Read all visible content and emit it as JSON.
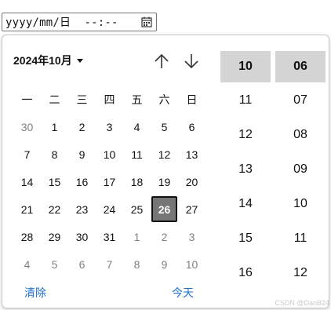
{
  "input": {
    "value": "yyyy/mm/日  --:--",
    "icon": "calendar-icon"
  },
  "calendar": {
    "month_label": "2024年10月",
    "weekdays": [
      "一",
      "二",
      "三",
      "四",
      "五",
      "六",
      "日"
    ],
    "weeks": [
      [
        {
          "d": "30",
          "other": true
        },
        {
          "d": "1"
        },
        {
          "d": "2"
        },
        {
          "d": "3"
        },
        {
          "d": "4"
        },
        {
          "d": "5"
        },
        {
          "d": "6"
        }
      ],
      [
        {
          "d": "7"
        },
        {
          "d": "8"
        },
        {
          "d": "9"
        },
        {
          "d": "10"
        },
        {
          "d": "11"
        },
        {
          "d": "12"
        },
        {
          "d": "13"
        }
      ],
      [
        {
          "d": "14"
        },
        {
          "d": "15"
        },
        {
          "d": "16"
        },
        {
          "d": "17"
        },
        {
          "d": "18"
        },
        {
          "d": "19"
        },
        {
          "d": "20"
        }
      ],
      [
        {
          "d": "21"
        },
        {
          "d": "22"
        },
        {
          "d": "23"
        },
        {
          "d": "24"
        },
        {
          "d": "25"
        },
        {
          "d": "26",
          "selected": true
        },
        {
          "d": "27"
        }
      ],
      [
        {
          "d": "28"
        },
        {
          "d": "29"
        },
        {
          "d": "30"
        },
        {
          "d": "31"
        },
        {
          "d": "1",
          "other": true
        },
        {
          "d": "2",
          "other": true
        },
        {
          "d": "3",
          "other": true
        }
      ],
      [
        {
          "d": "4",
          "other": true
        },
        {
          "d": "5",
          "other": true
        },
        {
          "d": "6",
          "other": true
        },
        {
          "d": "7",
          "other": true
        },
        {
          "d": "8",
          "other": true
        },
        {
          "d": "9",
          "other": true
        },
        {
          "d": "10",
          "other": true
        }
      ]
    ],
    "clear_label": "清除",
    "today_label": "今天"
  },
  "time": {
    "hours": [
      "10",
      "11",
      "12",
      "13",
      "14",
      "15",
      "16"
    ],
    "minutes": [
      "06",
      "07",
      "08",
      "09",
      "10",
      "11",
      "12"
    ],
    "selected_hour": "10",
    "selected_minute": "06"
  },
  "watermark": "CSDN @DanB24",
  "colors": {
    "link": "#1f6fd1",
    "selected_day_bg": "#767676",
    "selected_time_bg": "#d4d4d4"
  }
}
